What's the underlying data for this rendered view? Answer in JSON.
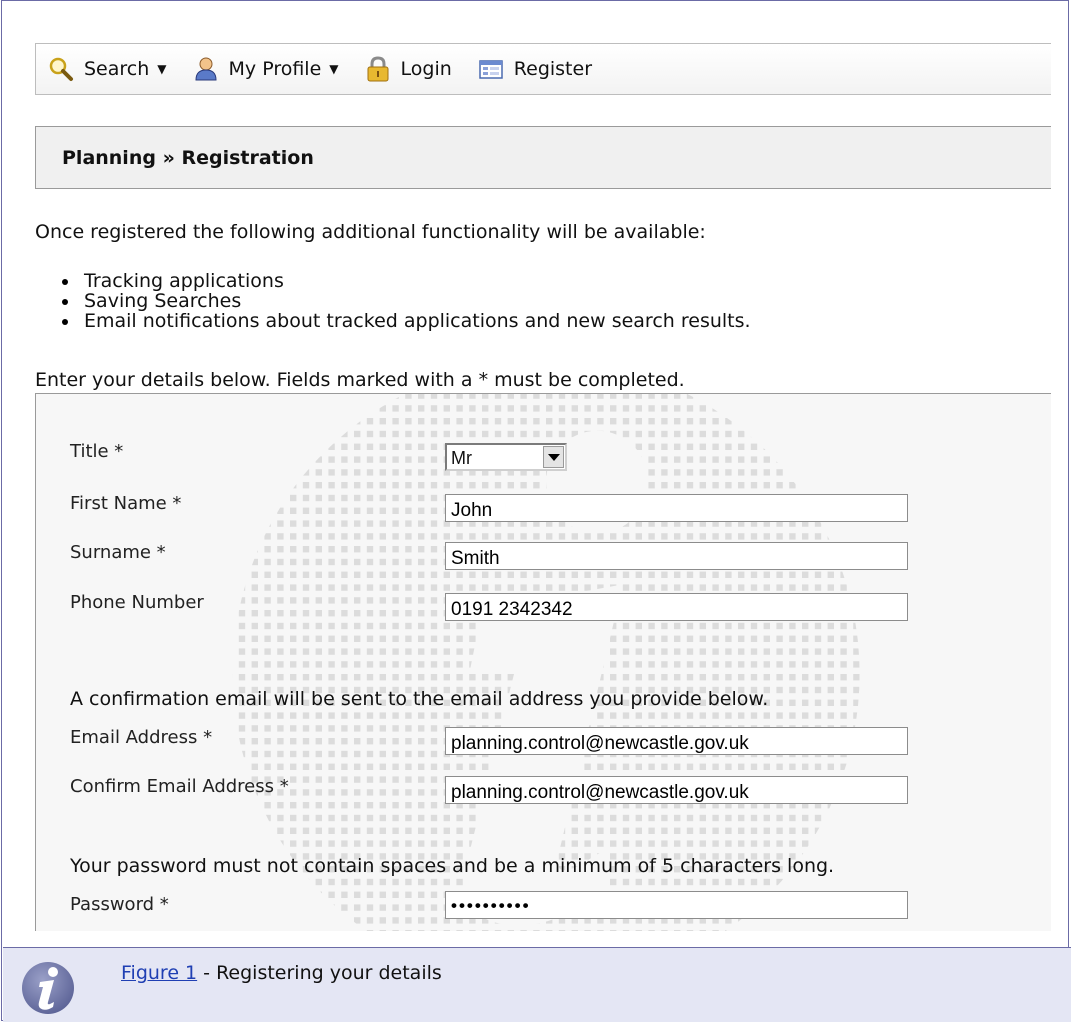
{
  "toolbar": {
    "items": [
      {
        "label": "Search",
        "icon": "search-icon",
        "has_dropdown": true
      },
      {
        "label": "My Profile",
        "icon": "user-icon",
        "has_dropdown": true
      },
      {
        "label": "Login",
        "icon": "lock-icon",
        "has_dropdown": false
      },
      {
        "label": "Register",
        "icon": "form-icon",
        "has_dropdown": false
      }
    ]
  },
  "breadcrumb": "Planning » Registration",
  "intro": "Once registered the following additional functionality will be available:",
  "features": [
    "Tracking applications",
    "Saving Searches",
    "Email notifications about tracked applications and new search results."
  ],
  "enter_details": "Enter your details below. Fields marked with a * must be completed.",
  "form": {
    "title_label": "Title *",
    "title_value": "Mr",
    "first_name_label": "First Name *",
    "first_name_value": "John",
    "surname_label": "Surname *",
    "surname_value": "Smith",
    "phone_label": "Phone Number",
    "phone_value": "0191 2342342",
    "email_note": "A confirmation email will be sent to the email address you provide below.",
    "email_label": "Email Address *",
    "email_value": "planning.control@newcastle.gov.uk",
    "confirm_email_label": "Confirm Email Address *",
    "confirm_email_value": "planning.control@newcastle.gov.uk",
    "password_note": "Your password must not contain spaces and be a minimum of 5 characters long.",
    "password_label": "Password *",
    "password_value": "••••••••••"
  },
  "caption": {
    "link": "Figure 1",
    "text": " - Registering your details"
  },
  "colors": {
    "frame_border": "#6b6ba6",
    "caption_bg": "#e4e6f4",
    "link": "#1f3fb3"
  }
}
